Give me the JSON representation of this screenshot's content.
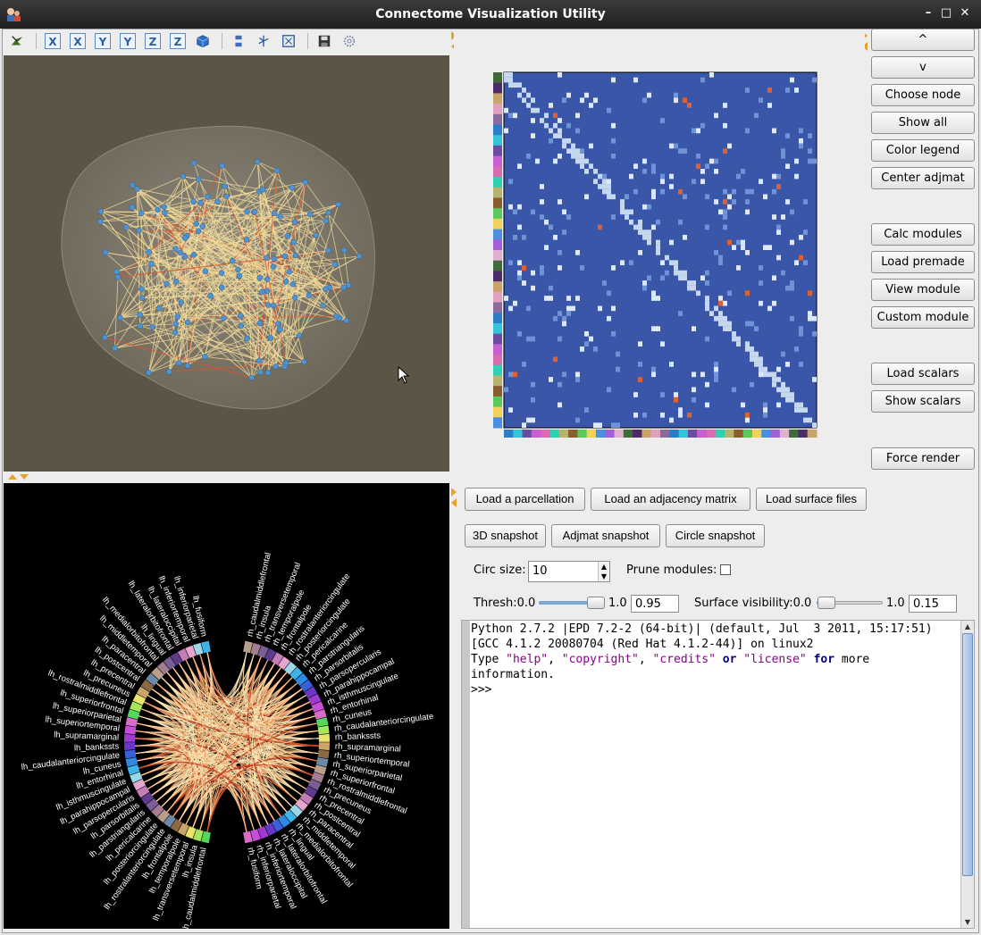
{
  "window": {
    "title": "Connectome Visualization Utility",
    "controls": {
      "minimize": "–",
      "maximize": "□",
      "close": "✕"
    }
  },
  "toolbar": {
    "items": [
      {
        "icon": "pick-icon"
      },
      {
        "icon": "view-x-icon",
        "label": "X"
      },
      {
        "icon": "view-x-neg-icon",
        "label": "X"
      },
      {
        "icon": "view-y-icon",
        "label": "Y"
      },
      {
        "icon": "view-y-neg-icon",
        "label": "Y"
      },
      {
        "icon": "view-z-icon",
        "label": "Z"
      },
      {
        "icon": "view-z-neg-icon",
        "label": "Z"
      },
      {
        "icon": "isometric-cube-icon"
      },
      {
        "icon": "parallel-projection-icon"
      },
      {
        "icon": "axes-icon"
      },
      {
        "icon": "fullscreen-icon"
      },
      {
        "icon": "save-icon"
      },
      {
        "icon": "config-gear-icon"
      }
    ]
  },
  "right_panel": {
    "buttons": [
      "^",
      "v",
      "Choose node",
      "Show all",
      "Color legend",
      "Center adjmat",
      "Calc modules",
      "Load premade",
      "View module",
      "Custom module",
      "Load scalars",
      "Show scalars",
      "Force render"
    ]
  },
  "load_buttons": [
    "Load a parcellation",
    "Load an adjacency matrix",
    "Load surface files"
  ],
  "snapshot_buttons": [
    "3D snapshot",
    "Adjmat snapshot",
    "Circle snapshot"
  ],
  "options": {
    "circ_size_label": "Circ size:",
    "circ_size_value": "10",
    "prune_label": "Prune modules:",
    "prune_checked": false,
    "thresh_label": "Thresh:0.0",
    "thresh_max": "1.0",
    "thresh_value": "0.95",
    "thresh_fraction": 0.95,
    "surface_label": "Surface visibility:0.0",
    "surface_max": "1.0",
    "surface_value": "0.15",
    "surface_fraction": 0.15
  },
  "console": {
    "line1": "Python 2.7.2 |EPD 7.2-2 (64-bit)| (default, Jul  3 2011, 15:17:51)",
    "line2": "[GCC 4.1.2 20080704 (Red Hat 4.1.2-44)] on linux2",
    "line3_a": "Type ",
    "line3_help": "\"help\"",
    "line3_c1": ", ",
    "line3_copyright": "\"copyright\"",
    "line3_c2": ", ",
    "line3_credits": "\"credits\"",
    "line3_or": "or",
    "line3_license": "\"license\"",
    "line3_for": "for",
    "line3_more": " more",
    "line4": "information.",
    "prompt": ">>>"
  },
  "circle_labels": {
    "left_hemisphere": [
      "lh_caudalmiddlefrontal",
      "lh_insula",
      "lh_transversetemporal",
      "lh_temporalpole",
      "lh_frontalpole",
      "lh_rostralanteriorcingulate",
      "lh_posteriorcingulate",
      "lh_pericalcarine",
      "lh_parstriangularis",
      "lh_parsorbitalis",
      "lh_parsopercularis",
      "lh_parahippocampal",
      "lh_isthmuscingulate",
      "lh_entorhinal",
      "lh_cuneus",
      "lh_caudalanteriorcingulate",
      "lh_bankssts",
      "lh_supramarginal",
      "lh_superiortemporal",
      "lh_superiorparietal",
      "lh_superiorfrontal",
      "lh_rostralmiddlefrontal",
      "lh_precuneus",
      "lh_precentral",
      "lh_postcentral",
      "lh_paracentral",
      "lh_middletemporal",
      "lh_medialorbitofrontal",
      "lh_lingual",
      "lh_lateralorbitofrontal",
      "lh_lateraloccipital",
      "lh_inferiortemporal",
      "lh_inferiorparietal",
      "lh_fusiform"
    ],
    "right_hemisphere": [
      "rh_caudalmiddlefrontal",
      "rh_insula",
      "rh_transversetemporal",
      "rh_temporalpole",
      "rh_frontalpole",
      "rh_rostralanteriorcingulate",
      "rh_posteriorcingulate",
      "rh_pericalcarine",
      "rh_parstriangularis",
      "rh_parsorbitalis",
      "rh_parsopercularis",
      "rh_parahippocampal",
      "rh_isthmuscingulate",
      "rh_entorhinal",
      "rh_cuneus",
      "rh_caudalanteriorcingulate",
      "rh_bankssts",
      "rh_supramarginal",
      "rh_superiortemporal",
      "rh_superiorparietal",
      "rh_superiorfrontal",
      "rh_rostralmiddlefrontal",
      "rh_precuneus",
      "rh_precentral",
      "rh_postcentral",
      "rh_paracentral",
      "rh_middletemporal",
      "rh_medialorbitofrontal",
      "rh_lingual",
      "rh_lateralorbitofrontal",
      "rh_lateraloccipital",
      "rh_inferiortemporal",
      "rh_inferiorparietal",
      "rh_fusiform"
    ]
  },
  "colors": {
    "view3d_bg": "#5b5546",
    "matrix_bg": "#3a56a8",
    "node_blue": "#4f93d1",
    "edge_yellow": "#f4dc9a",
    "circle_bg": "#000000"
  }
}
